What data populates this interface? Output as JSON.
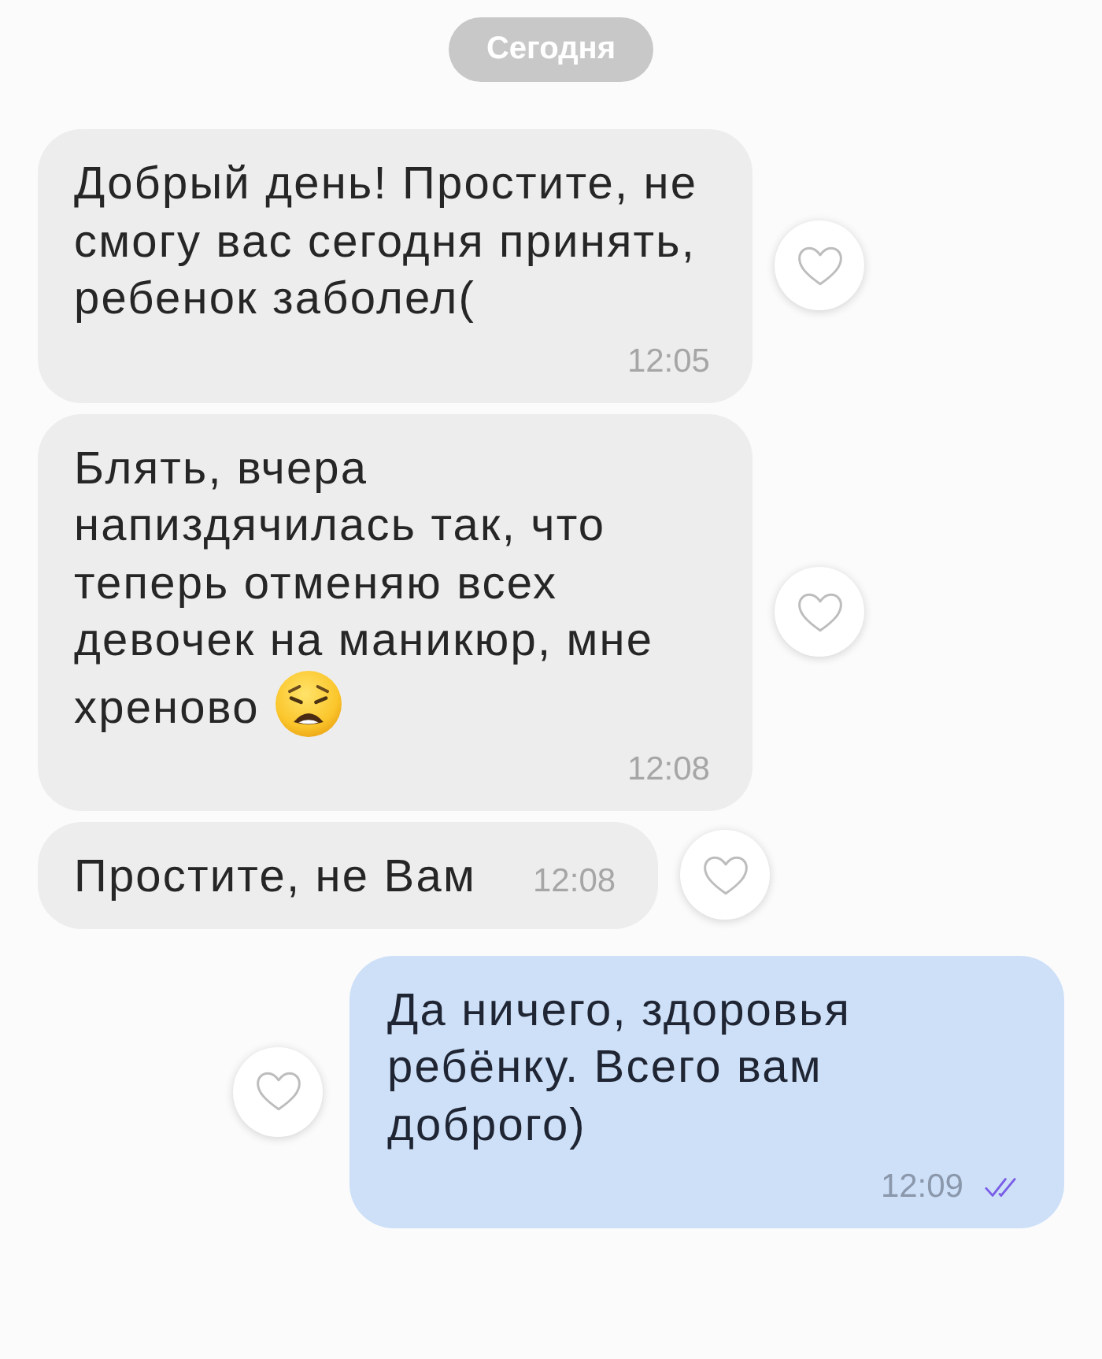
{
  "date_badge": "Сегодня",
  "messages": [
    {
      "kind": "incoming",
      "text": "Добрый день! Простите, не смогу вас сегодня принять, ребенок заболел(",
      "has_emoji": false,
      "time": "12:05",
      "liked": false
    },
    {
      "kind": "incoming",
      "text": "Блять, вчера напиздячилась так, что теперь отменяю всех девочек на маникюр, мне хреново",
      "has_emoji": true,
      "time": "12:08",
      "liked": false
    },
    {
      "kind": "incoming",
      "text": "Простите, не Вам",
      "has_emoji": false,
      "time": "12:08",
      "liked": false
    },
    {
      "kind": "outgoing",
      "text": "Да ничего, здоровья ребёнку. Всего вам доброго)",
      "has_emoji": false,
      "time": "12:09",
      "liked": false,
      "read": true
    }
  ]
}
